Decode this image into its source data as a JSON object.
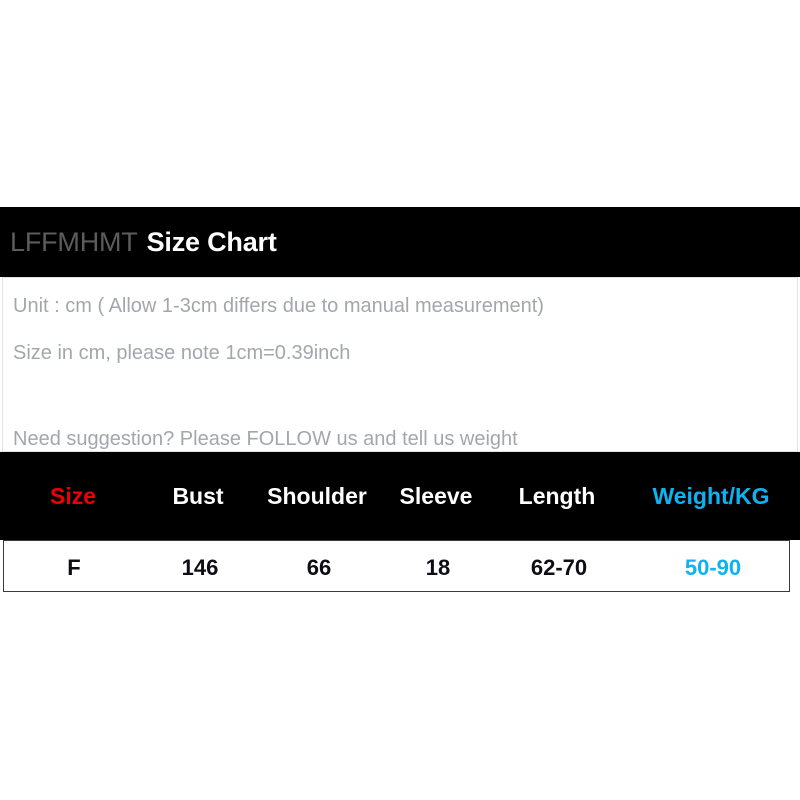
{
  "header": {
    "brand": "LFFMHMT",
    "title": "Size Chart"
  },
  "notes": {
    "line1": "Unit : cm ( Allow 1-3cm differs due to manual measurement)",
    "line2": "Size in cm, please note 1cm=0.39inch",
    "line3": "Need suggestion? Please FOLLOW us and tell us weight"
  },
  "colors": {
    "bar_background": "#000000",
    "panel_background": "#ffffff",
    "size_accent": "#ee0000",
    "weight_accent": "#0cb3f2",
    "note_text": "#a3a7ac",
    "brand_text": "#5c5c5c",
    "header_text": "#ffffff",
    "value_text": "#0d0d14"
  },
  "chart_data": {
    "type": "table",
    "title": "LFFMHMT Size Chart",
    "columns": [
      "Size",
      "Bust",
      "Shoulder",
      "Sleeve",
      "Length",
      "Weight/KG"
    ],
    "rows": [
      [
        "F",
        "146",
        "66",
        "18",
        "62-70",
        "50-90"
      ]
    ],
    "unit": "cm",
    "annotations": [
      "Unit : cm ( Allow 1-3cm differs due to manual measurement)",
      "Size in cm, please note 1cm=0.39inch",
      "Need suggestion? Please FOLLOW us and tell us weight"
    ]
  },
  "table": {
    "columns": [
      {
        "label": "Size",
        "center": 73,
        "style": "size"
      },
      {
        "label": "Bust",
        "center": 198,
        "style": "plain"
      },
      {
        "label": "Shoulder",
        "center": 317,
        "style": "plain"
      },
      {
        "label": "Sleeve",
        "center": 436,
        "style": "plain"
      },
      {
        "label": "Length",
        "center": 557,
        "style": "plain"
      },
      {
        "label": "Weight/KG",
        "center": 711,
        "style": "weight"
      }
    ],
    "values": [
      {
        "value": "F",
        "center": 70,
        "style": "plain"
      },
      {
        "value": "146",
        "center": 196,
        "style": "plain"
      },
      {
        "value": "66",
        "center": 315,
        "style": "plain"
      },
      {
        "value": "18",
        "center": 434,
        "style": "plain"
      },
      {
        "value": "62-70",
        "center": 555,
        "style": "plain"
      },
      {
        "value": "50-90",
        "center": 709,
        "style": "weight"
      }
    ]
  }
}
